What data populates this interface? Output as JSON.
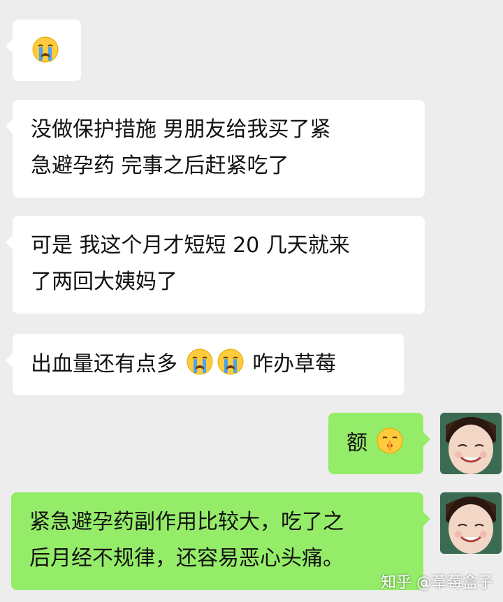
{
  "messages": [
    {
      "from": "left",
      "emoji": "crying-face-icon"
    },
    {
      "from": "left",
      "lines": [
        "没做保护措施 男朋友给我买了紧",
        "急避孕药 完事之后赶紧吃了"
      ]
    },
    {
      "from": "left",
      "lines": [
        "可是 我这个月才短短 20 几天就来",
        "了两回大姨妈了"
      ]
    },
    {
      "from": "left",
      "text_before": "出血量还有点多",
      "emoji": "crying-face-icon",
      "text_after": "咋办草莓"
    },
    {
      "from": "right",
      "text_before": "额",
      "emoji": "shushing-face-icon"
    },
    {
      "from": "right",
      "lines": [
        "紧急避孕药副作用比较大，吃了之",
        "后月经不规律，还容易恶心头痛。"
      ]
    }
  ],
  "watermark": "知乎 @草莓盒子",
  "colors": {
    "background": "#ededed",
    "left_bubble": "#ffffff",
    "right_bubble": "#95ec69"
  }
}
